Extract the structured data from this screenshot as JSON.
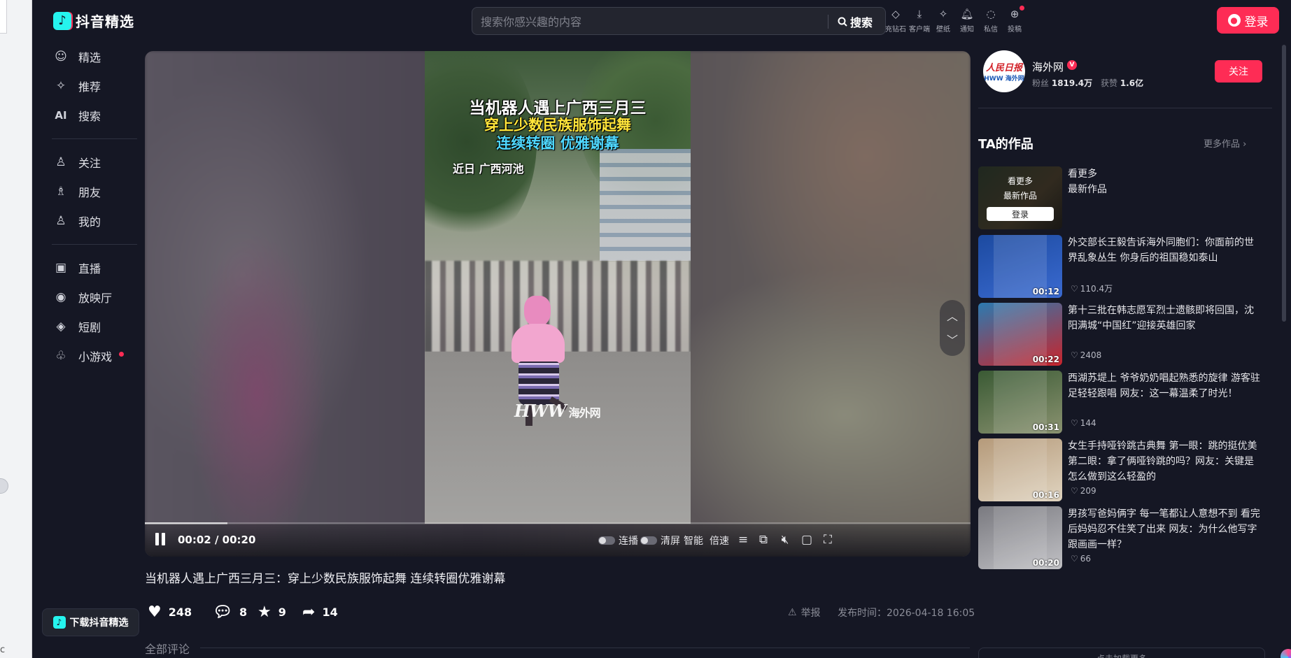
{
  "app": {
    "logo_text": "抖音精选",
    "logo_mark": "♪"
  },
  "search": {
    "placeholder": "搜索你感兴趣的内容",
    "button_label": "搜索"
  },
  "toolbar": [
    {
      "label": "充钻石",
      "icon": "diamond-icon"
    },
    {
      "label": "客户端",
      "icon": "download-icon"
    },
    {
      "label": "壁纸",
      "icon": "wallpaper-icon"
    },
    {
      "label": "通知",
      "icon": "bell-icon"
    },
    {
      "label": "私信",
      "icon": "message-icon"
    },
    {
      "label": "投稿",
      "icon": "upload-icon"
    }
  ],
  "login_label": "登录",
  "nav": {
    "items": [
      {
        "label": "精选",
        "icon": "featured-icon"
      },
      {
        "label": "推荐",
        "icon": "sparkle-icon"
      },
      {
        "label": "搜索",
        "icon": "ai-search-icon",
        "icon_text": "AI"
      },
      {
        "label": "关注",
        "icon": "follow-icon"
      },
      {
        "label": "朋友",
        "icon": "friends-icon"
      },
      {
        "label": "我的",
        "icon": "profile-icon"
      },
      {
        "label": "直播",
        "icon": "live-icon"
      },
      {
        "label": "放映厅",
        "icon": "theater-icon"
      },
      {
        "label": "短剧",
        "icon": "drama-icon"
      },
      {
        "label": "小游戏",
        "icon": "game-icon",
        "has_dot": true
      }
    ],
    "download_label": "下载抖音精选"
  },
  "player": {
    "caption_line1": "当机器人遇上广西三月三",
    "caption_line2": "穿上少数民族服饰起舞",
    "caption_line3": "连续转圈 优雅谢幕",
    "location_caption": "近日 广西河池",
    "watermark": "HWW",
    "watermark_cn": "海外网",
    "time": "00:02 / 00:20",
    "progress": 0.1,
    "controls": {
      "autoplay_label": "连播",
      "clear_label": "清屏",
      "smart_label": "智能",
      "speed_label": "倍速"
    }
  },
  "video": {
    "title": "当机器人遇上广西三月三：穿上少数民族服饰起舞 连续转圈优雅谢幕",
    "likes": "248",
    "comments": "8",
    "favorites": "9",
    "shares": "14",
    "report_label": "举报",
    "publish_time": "发布时间：2026-04-18 16:05",
    "comments_header": "全部评论"
  },
  "author": {
    "avatar_line1": "人民日报",
    "avatar_line2": "HWW 海外网",
    "name": "海外网",
    "verified_mark": "V",
    "fans_label": "粉丝",
    "fans": "1819.4万",
    "likes_label": "获赞",
    "likes": "1.6亿",
    "follow_label": "关注"
  },
  "works": {
    "title": "TA的作品",
    "more_label": "更多作品",
    "login_card": {
      "overlay_line1": "看更多",
      "overlay_line2": "最新作品",
      "overlay_button": "登录",
      "title": "看更多\n最新作品"
    },
    "items": [
      {
        "title": "外交部长王毅告诉海外同胞们：你面前的世界乱象丛生 你身后的祖国稳如泰山",
        "duration": "00:12",
        "likes": "110.4万",
        "colors": [
          "#1c4aa0",
          "#3a6ad0"
        ]
      },
      {
        "title": "第十三批在韩志愿军烈士遗骸即将回国，沈阳满城“中国红”迎接英雄回家",
        "duration": "00:22",
        "likes": "2408",
        "colors": [
          "#2c7ab0",
          "#c8242c"
        ]
      },
      {
        "title": "西湖苏堤上 爷爷奶奶唱起熟悉的旋律 游客驻足轻轻跟唱 网友：这一幕温柔了时光！",
        "duration": "00:31",
        "likes": "144",
        "colors": [
          "#3a5a34",
          "#8a9270"
        ]
      },
      {
        "title": "女生手持哑铃跳古典舞 第一眼：跳的挺优美 第二眼：拿了俩哑铃跳的吗？网友：关键是怎么做到这么轻盈的",
        "duration": "00:16",
        "likes": "209",
        "colors": [
          "#b59a7a",
          "#e0d4c0"
        ]
      },
      {
        "title": "男孩写爸妈俩字 每一笔都让人意想不到 看完后妈妈忍不住笑了出来 网友：为什么他写字跟画画一样？",
        "duration": "00:20",
        "likes": "66",
        "colors": [
          "#7a7a80",
          "#c0c0c4"
        ]
      }
    ],
    "load_more_label": "点击加载更多"
  },
  "colors": {
    "accent": "#fe2c55",
    "background": "#151724",
    "brand_cyan": "#25f4ee"
  }
}
